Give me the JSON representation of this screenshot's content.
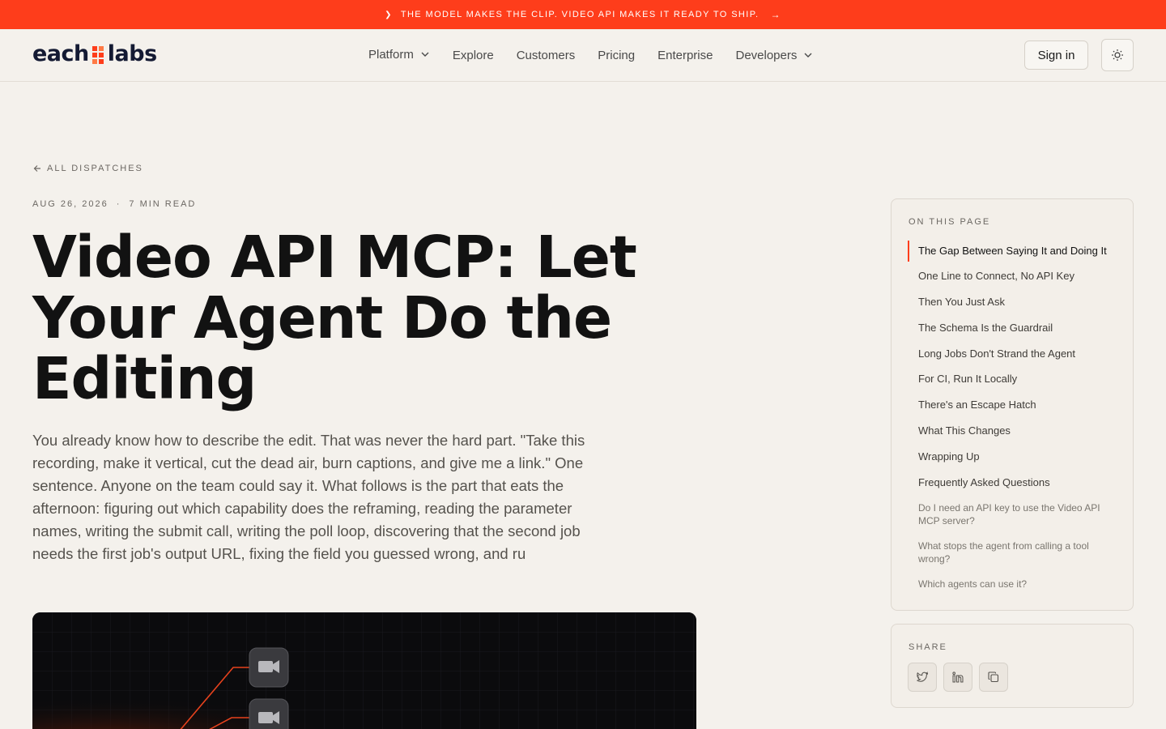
{
  "banner": {
    "text": "THE MODEL MAKES THE CLIP. VIDEO API MAKES IT READY TO SHIP.",
    "chevron": "❯",
    "arrow": "→"
  },
  "header": {
    "logo_left": "each",
    "logo_right": "labs",
    "nav": [
      "Platform",
      "Explore",
      "Customers",
      "Pricing",
      "Enterprise",
      "Developers"
    ],
    "signin_label": "Sign in"
  },
  "article": {
    "back_label": "ALL DISPATCHES",
    "date": "AUG 26, 2026",
    "separator": "·",
    "read_time": "7 MIN READ",
    "title": "Video API MCP: Let Your Agent Do the Editing",
    "lede": "You already know how to describe the edit. That was never the hard part. \"Take this recording, make it vertical, cut the dead air, burn captions, and give me a link.\" One sentence. Anyone on the team could say it. What follows is the part that eats the afternoon: figuring out which capability does the reframing, reading the parameter names, writing the submit call, writing the poll loop, discovering that the second job needs the first job's output URL, fixing the field you guessed wrong, and ru"
  },
  "toc": {
    "heading": "ON THIS PAGE",
    "items": [
      "The Gap Between Saying It and Doing It",
      "One Line to Connect, No API Key",
      "Then You Just Ask",
      "The Schema Is the Guardrail",
      "Long Jobs Don't Strand the Agent",
      "For CI, Run It Locally",
      "There's an Escape Hatch",
      "What This Changes",
      "Wrapping Up",
      "Frequently Asked Questions"
    ],
    "sub_items": [
      "Do I need an API key to use the Video API MCP server?",
      "What stops the agent from calling a tool wrong?",
      "Which agents can use it?"
    ]
  },
  "share": {
    "heading": "SHARE",
    "buttons": [
      "twitter-icon",
      "linkedin-icon",
      "copy-icon"
    ]
  },
  "colors": {
    "accent": "#fe3d1b",
    "background": "#f4f1ec",
    "logo": "#141a33"
  }
}
